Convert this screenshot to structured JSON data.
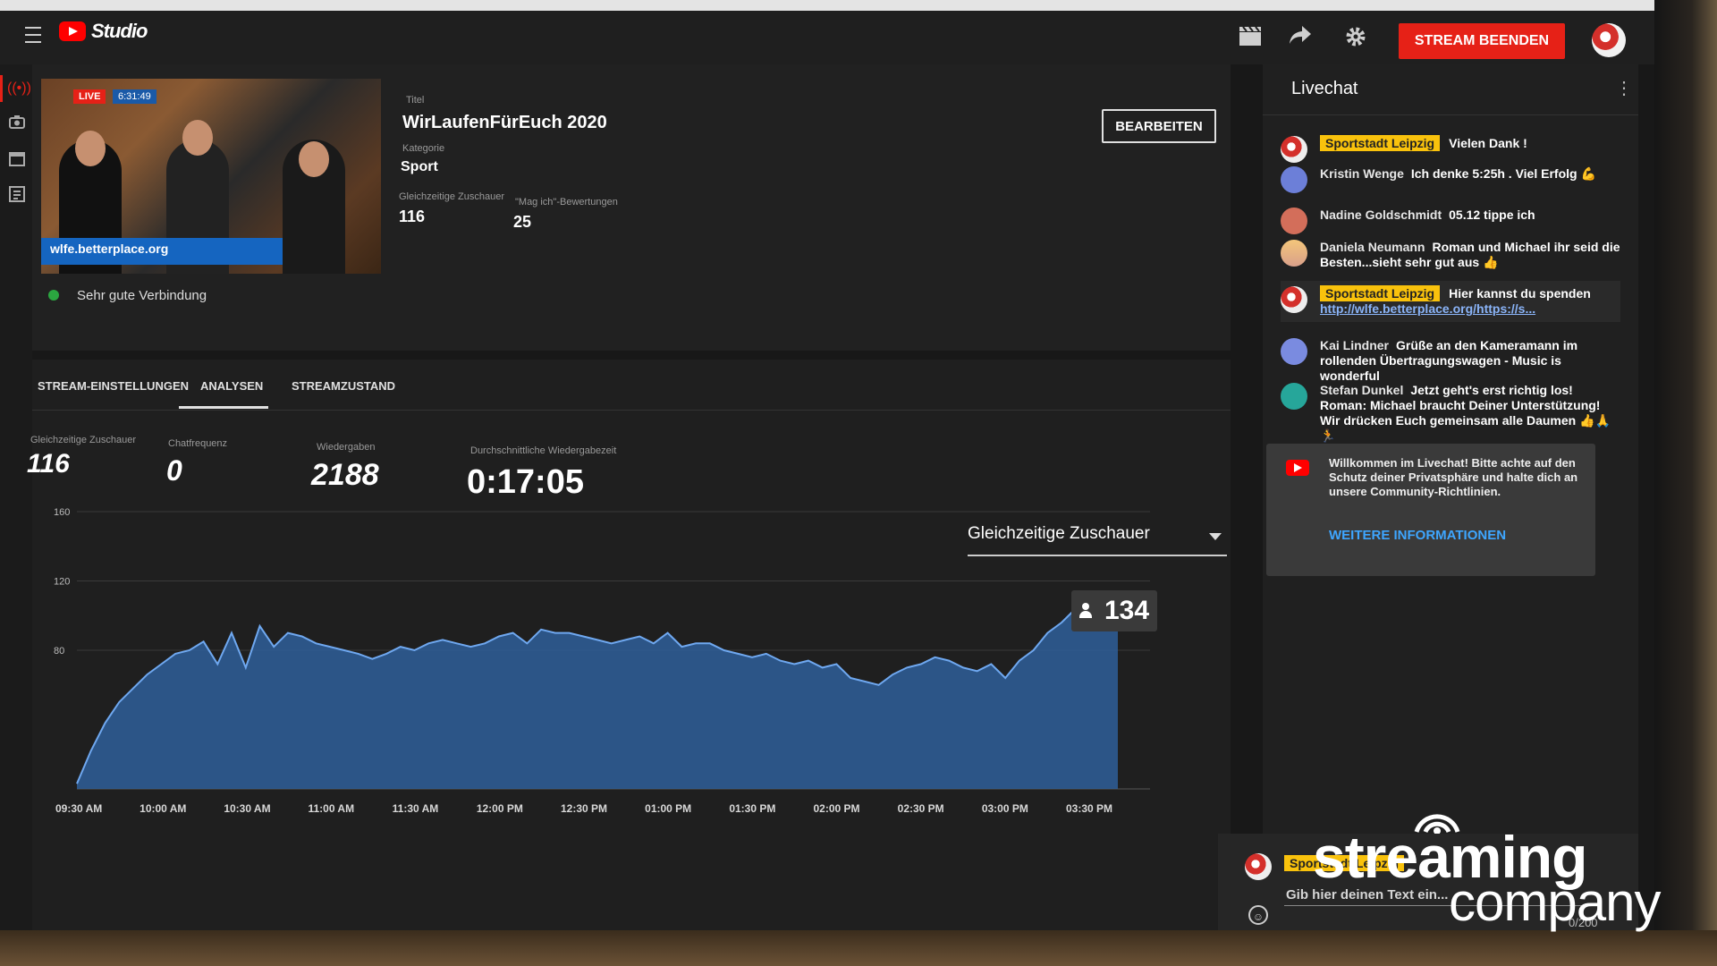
{
  "app": {
    "logo_text": "Studio"
  },
  "header": {
    "end_stream_label": "STREAM BEENDEN"
  },
  "stream": {
    "live_label": "LIVE",
    "live_time": "6:31:49",
    "thumb_banner": "wlfe.betterplace.org",
    "connection": "Sehr gute Verbindung",
    "title_label": "Titel",
    "title": "WirLaufenFürEuch 2020",
    "category_label": "Kategorie",
    "category": "Sport",
    "concurrent_label": "Gleichzeitige Zuschauer",
    "concurrent": "116",
    "likes_label": "\"Mag ich\"-Bewertungen",
    "likes": "25",
    "edit_label": "BEARBEITEN"
  },
  "tabs": [
    "STREAM-EINSTELLUNGEN",
    "ANALYSEN",
    "STREAMZUSTAND"
  ],
  "metrics": [
    {
      "label": "Gleichzeitige Zuschauer",
      "value": "116"
    },
    {
      "label": "Chatfrequenz",
      "value": "0"
    },
    {
      "label": "Wiedergaben",
      "value": "2188"
    },
    {
      "label": "Durchschnittliche Wiedergabezeit",
      "value": "0:17:05"
    }
  ],
  "chart": {
    "metric_select": "Gleichzeitige Zuschauer",
    "tooltip_value": "134"
  },
  "chart_data": {
    "type": "area",
    "title": "",
    "xlabel": "",
    "ylabel": "",
    "x_ticks": [
      "09:30 AM",
      "10:00 AM",
      "10:30 AM",
      "11:00 AM",
      "11:30 AM",
      "12:00 PM",
      "12:30 PM",
      "01:00 PM",
      "01:30 PM",
      "02:00 PM",
      "02:30 PM",
      "03:00 PM",
      "03:30 PM"
    ],
    "y_ticks": [
      160,
      120,
      80
    ],
    "ylim": [
      0,
      160
    ],
    "grid": true,
    "series": [
      {
        "values": [
          3,
          22,
          38,
          50,
          58,
          66,
          72,
          78,
          80,
          85,
          72,
          90,
          70,
          94,
          82,
          90,
          88,
          84,
          82,
          80,
          78,
          75,
          78,
          82,
          80,
          84,
          86,
          84,
          82,
          84,
          88,
          90,
          84,
          92,
          90,
          90,
          88,
          86,
          84,
          86,
          88,
          84,
          90,
          82,
          84,
          84,
          80,
          78,
          76,
          78,
          74,
          72,
          74,
          70,
          72,
          64,
          62,
          60,
          66,
          70,
          72,
          76,
          74,
          70,
          68,
          72,
          64,
          74,
          80,
          90,
          96,
          104,
          100,
          98,
          96
        ]
      }
    ]
  },
  "chat": {
    "title": "Livechat",
    "messages": [
      {
        "author": "Sportstadt Leipzig",
        "owner": true,
        "text": "Vielen Dank !"
      },
      {
        "author": "Kristin Wenge",
        "owner": false,
        "text": "Ich denke 5:25h . Viel Erfolg 💪"
      },
      {
        "author": "Nadine Goldschmidt",
        "owner": false,
        "text": "05.12 tippe ich"
      },
      {
        "author": "Daniela Neumann",
        "owner": false,
        "text": "Roman und Michael ihr seid die Besten...sieht sehr gut aus 👍"
      },
      {
        "author": "Sportstadt Leipzig",
        "owner": true,
        "text": "Hier kannst du spenden",
        "link": "http://wlfe.betterplace.org/https://s..."
      },
      {
        "author": "Kai Lindner",
        "owner": false,
        "text": "Grüße an den Kameramann im rollenden Übertragungswagen - Music is wonderful"
      },
      {
        "author": "Stefan Dunkel",
        "owner": false,
        "text": "Jetzt geht's erst richtig los! Roman: Michael braucht Deiner Unterstützung! Wir drücken Euch gemeinsam alle Daumen 👍🙏🏃"
      }
    ],
    "welcome_text": "Willkommen im Livechat! Bitte achte auf den Schutz deiner Privatsphäre und halte dich an unsere Community-Richtlinien.",
    "welcome_link": "WEITERE INFORMATIONEN",
    "compose_name": "Sportstadt Leipzig",
    "compose_placeholder": "Gib hier deinen Text ein...",
    "char_count": "0/200"
  },
  "watermark": {
    "line1": "streaming",
    "line2": "company"
  },
  "colors": {
    "accent_red": "#e62117",
    "chart_fill": "#2f5f9a",
    "chart_line": "#6fa8f0",
    "owner_badge": "#f9c20c",
    "link_blue": "#3ea6ff"
  }
}
